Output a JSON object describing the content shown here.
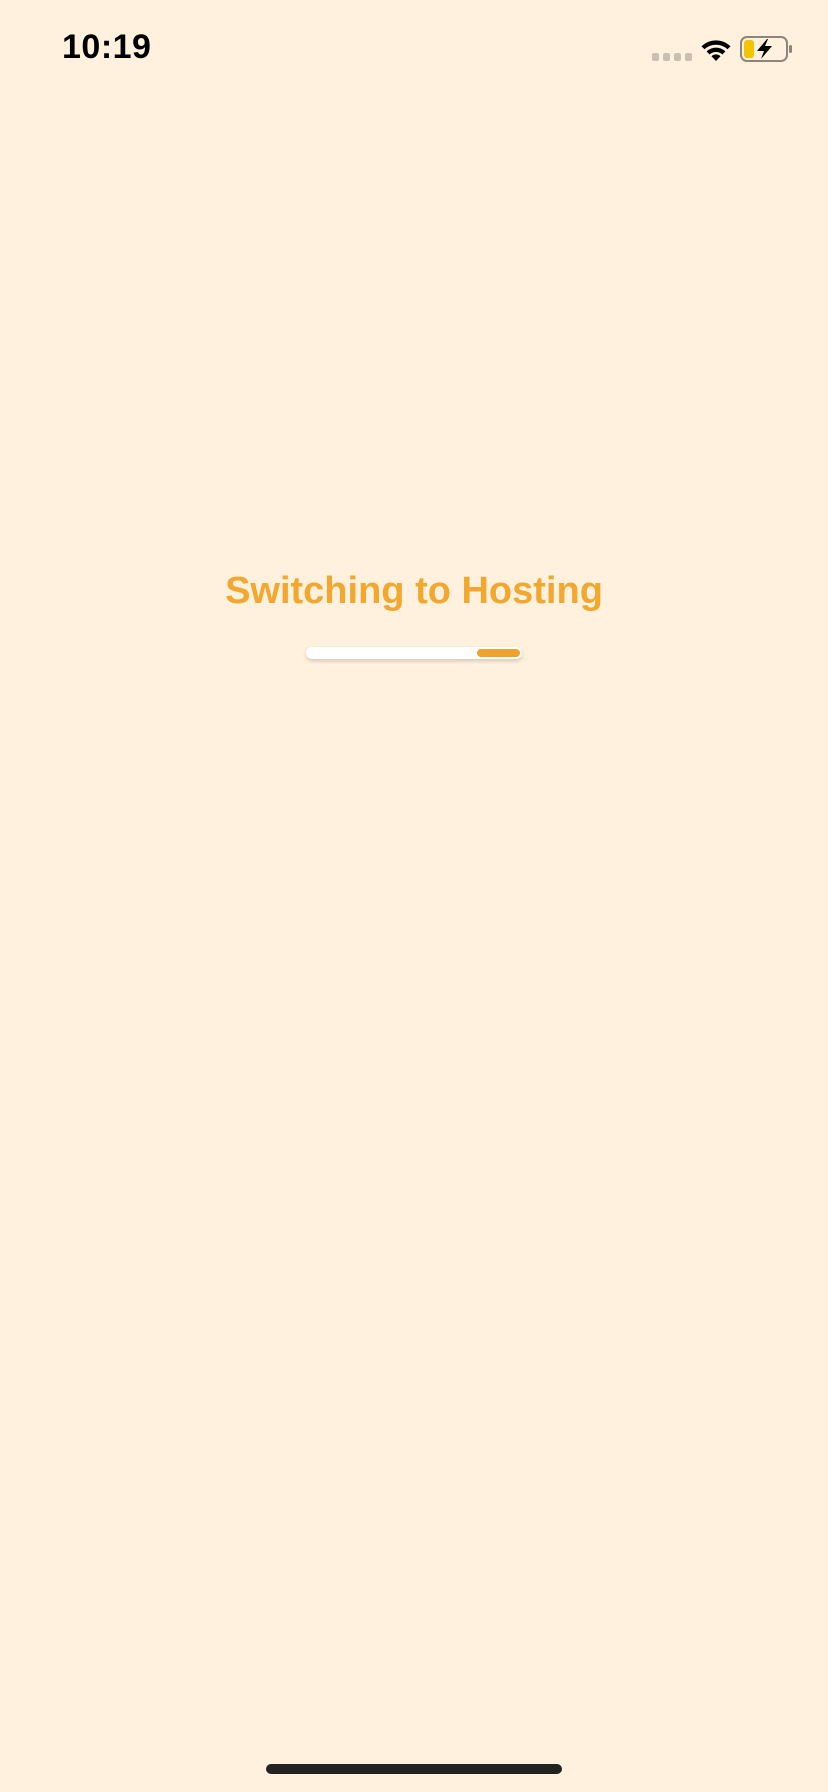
{
  "status_bar": {
    "time": "10:19",
    "signal_icon": "cellular-signal-dots",
    "wifi_icon": "wifi-icon",
    "battery_icon": "battery-charging-icon",
    "battery_level": 0.25,
    "battery_color": "#F5C400",
    "charging": true
  },
  "loading": {
    "title": "Switching to Hosting",
    "title_color": "#F2A72E",
    "progress_indicator": {
      "type": "indeterminate",
      "track_color": "#FFFFFF",
      "fill_color": "#EFA22E",
      "fill_start": 0.79,
      "fill_end": 1.0
    }
  },
  "background_color": "#FFF1DE"
}
